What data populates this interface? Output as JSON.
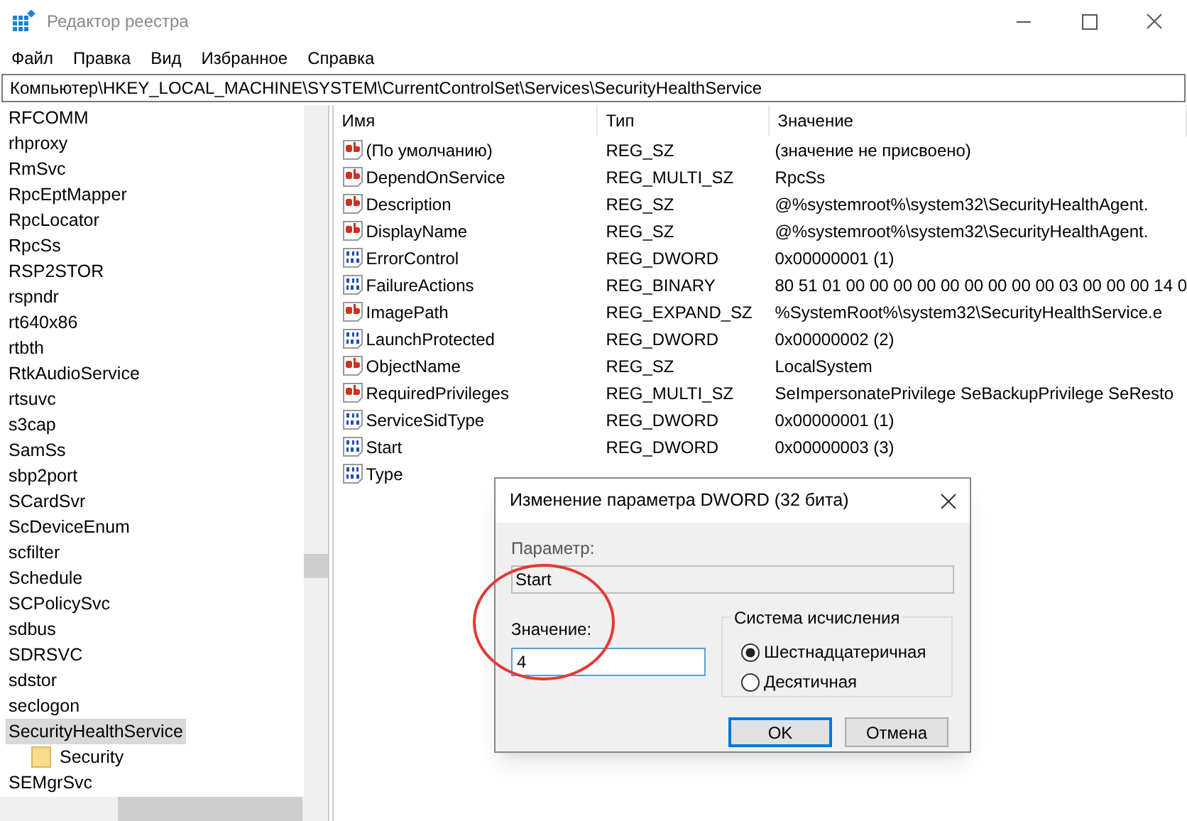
{
  "window": {
    "title": "Редактор реестра"
  },
  "menu": [
    "Файл",
    "Правка",
    "Вид",
    "Избранное",
    "Справка"
  ],
  "address": "Компьютер\\HKEY_LOCAL_MACHINE\\SYSTEM\\CurrentControlSet\\Services\\SecurityHealthService",
  "tree": [
    {
      "label": "RFCOMM",
      "selected": false
    },
    {
      "label": "rhproxy",
      "selected": false
    },
    {
      "label": "RmSvc",
      "selected": false
    },
    {
      "label": "RpcEptMapper",
      "selected": false
    },
    {
      "label": "RpcLocator",
      "selected": false
    },
    {
      "label": "RpcSs",
      "selected": false
    },
    {
      "label": "RSP2STOR",
      "selected": false
    },
    {
      "label": "rspndr",
      "selected": false
    },
    {
      "label": "rt640x86",
      "selected": false
    },
    {
      "label": "rtbth",
      "selected": false
    },
    {
      "label": "RtkAudioService",
      "selected": false
    },
    {
      "label": "rtsuvc",
      "selected": false
    },
    {
      "label": "s3cap",
      "selected": false
    },
    {
      "label": "SamSs",
      "selected": false
    },
    {
      "label": "sbp2port",
      "selected": false
    },
    {
      "label": "SCardSvr",
      "selected": false
    },
    {
      "label": "ScDeviceEnum",
      "selected": false
    },
    {
      "label": "scfilter",
      "selected": false
    },
    {
      "label": "Schedule",
      "selected": false
    },
    {
      "label": "SCPolicySvc",
      "selected": false
    },
    {
      "label": "sdbus",
      "selected": false
    },
    {
      "label": "SDRSVC",
      "selected": false
    },
    {
      "label": "sdstor",
      "selected": false
    },
    {
      "label": "seclogon",
      "selected": false
    },
    {
      "label": "SecurityHealthService",
      "selected": true,
      "children": [
        {
          "label": "Security",
          "selected": false
        }
      ]
    },
    {
      "label": "SEMgrSvc",
      "selected": false
    }
  ],
  "table": {
    "columns": [
      "Имя",
      "Тип",
      "Значение"
    ],
    "rows": [
      {
        "kind": "string",
        "name": "(По умолчанию)",
        "type": "REG_SZ",
        "value": "(значение не присвоено)"
      },
      {
        "kind": "string",
        "name": "DependOnService",
        "type": "REG_MULTI_SZ",
        "value": "RpcSs"
      },
      {
        "kind": "string",
        "name": "Description",
        "type": "REG_SZ",
        "value": "@%systemroot%\\system32\\SecurityHealthAgent."
      },
      {
        "kind": "string",
        "name": "DisplayName",
        "type": "REG_SZ",
        "value": "@%systemroot%\\system32\\SecurityHealthAgent."
      },
      {
        "kind": "binary",
        "name": "ErrorControl",
        "type": "REG_DWORD",
        "value": "0x00000001 (1)"
      },
      {
        "kind": "binary",
        "name": "FailureActions",
        "type": "REG_BINARY",
        "value": "80 51 01 00 00 00 00 00 00 00 00 00 03 00 00 00 14 0"
      },
      {
        "kind": "string",
        "name": "ImagePath",
        "type": "REG_EXPAND_SZ",
        "value": "%SystemRoot%\\system32\\SecurityHealthService.e"
      },
      {
        "kind": "binary",
        "name": "LaunchProtected",
        "type": "REG_DWORD",
        "value": "0x00000002 (2)"
      },
      {
        "kind": "string",
        "name": "ObjectName",
        "type": "REG_SZ",
        "value": "LocalSystem"
      },
      {
        "kind": "string",
        "name": "RequiredPrivileges",
        "type": "REG_MULTI_SZ",
        "value": "SeImpersonatePrivilege SeBackupPrivilege SeResto"
      },
      {
        "kind": "binary",
        "name": "ServiceSidType",
        "type": "REG_DWORD",
        "value": "0x00000001 (1)"
      },
      {
        "kind": "binary",
        "name": "Start",
        "type": "REG_DWORD",
        "value": "0x00000003 (3)"
      },
      {
        "kind": "binary",
        "name": "Type"
      }
    ]
  },
  "dialog": {
    "title": "Изменение параметра DWORD (32 бита)",
    "param_label": "Параметр:",
    "param_value": "Start",
    "value_label": "Значение:",
    "value": "4",
    "base_group": "Система исчисления",
    "bases": [
      {
        "label": "Шестнадцатеричная",
        "selected": true
      },
      {
        "label": "Десятичная",
        "selected": false
      }
    ],
    "buttons": [
      "OK",
      "Отмена"
    ]
  }
}
